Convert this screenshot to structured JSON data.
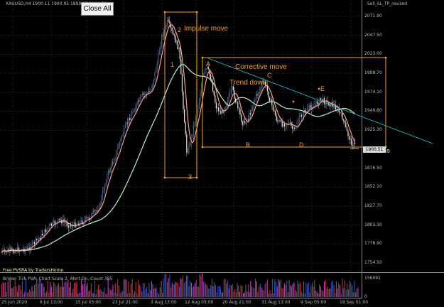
{
  "header": {
    "symbol_info": "XAUUSD,H4  1900.11 1900.95 1899.87 1900.51",
    "ea_name": "Sell_SL_TP_revised"
  },
  "buttons": {
    "close_all": "Close All"
  },
  "indicators": {
    "vsra_label": "Free PVSRA by TradersHome",
    "tick_pva": "Broker Tick PVA:   Chart Scale  2,  Alert On,  Count  385",
    "volume_axis": [
      "156091",
      "0"
    ]
  },
  "annotations": {
    "impulse": "Impulse move",
    "corrective": "Corrective move",
    "trend_down": "Trend down",
    "wave_1": "1",
    "wave_2": "2",
    "wave_3": "3",
    "point_a": "A",
    "point_b": "B",
    "point_c": "C",
    "point_d": "D",
    "point_e": "E",
    "countdown": "<--3:56:39"
  },
  "price_axis": [
    "2071.90",
    "2047.50",
    "2023.00",
    "1998.70",
    "1974.10",
    "1949.80",
    "1925.30",
    "1900.51",
    "1876.50",
    "1852.10",
    "1827.70",
    "1803.30",
    "1778.90",
    "1754.50"
  ],
  "current_price": "1900.51",
  "time_axis": [
    "25 Jun 2020",
    "6 Jul 13:00",
    "15 Jul 05:00",
    "23 Jul 21:00",
    "3 Aug 13:00",
    "12 Aug 05:00",
    "20 Aug 21:00",
    "31 Aug 13:00",
    "9 Sep 05:00",
    "18 Sep 01:00"
  ],
  "colors": {
    "background": "#000000",
    "grid": "#2e2e2e",
    "bull_candle": "#3f5d8c",
    "bear_candle": "#e8e8e8",
    "ma_fast": "#ff9f8a",
    "ma_slow": "#b8f5c8",
    "annotation": "#f0a030",
    "trendline": "#20c8d0",
    "volume_red": "#c03030",
    "volume_blue": "#3050c0",
    "volume_magenta": "#c040c0"
  }
}
